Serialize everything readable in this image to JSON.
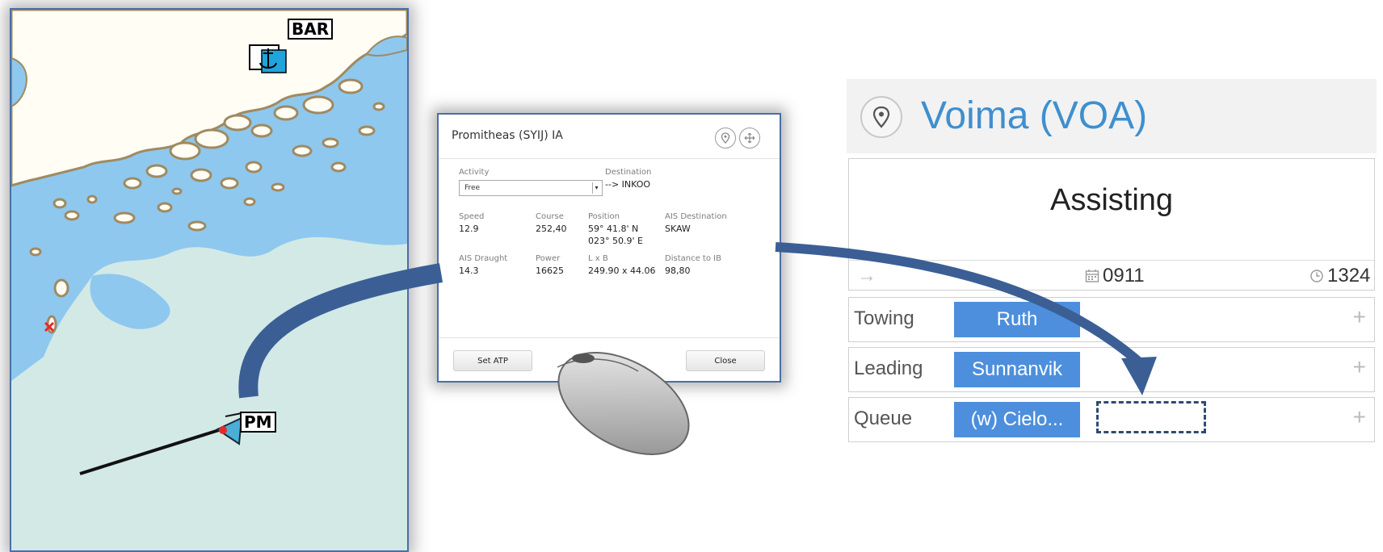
{
  "map": {
    "labels": {
      "bar": "BAR",
      "pm": "PM"
    },
    "colors": {
      "land": "#fffdf4",
      "coast": "#a08a60",
      "shallow": "#8ec8ef",
      "deep": "#d3e9e6",
      "track": "#111111",
      "ship": "#4aaed9",
      "highlight": "#e8292a"
    },
    "icons": [
      "anchor-icon",
      "ship-icon",
      "cross-marker-icon"
    ]
  },
  "dialog": {
    "title": "Promitheas (SYIJ) IA",
    "activity": {
      "label": "Activity",
      "value": "Free"
    },
    "destination": {
      "label": "Destination",
      "value": "--> INKOO"
    },
    "speed": {
      "label": "Speed",
      "value": "12.9"
    },
    "course": {
      "label": "Course",
      "value": "252,40"
    },
    "position": {
      "label": "Position",
      "lat": "59° 41.8' N",
      "lon": "023° 50.9' E"
    },
    "ais_destination": {
      "label": "AIS Destination",
      "value": "SKAW"
    },
    "ais_draught": {
      "label": "AIS Draught",
      "value": "14.3"
    },
    "power": {
      "label": "Power",
      "value": "16625"
    },
    "lxb": {
      "label": "L x B",
      "value": "249.90 x 44.06"
    },
    "distance_to_ib": {
      "label": "Distance to IB",
      "value": "98,80"
    },
    "buttons": {
      "set_atp": "Set ATP",
      "close": "Close"
    },
    "icons": [
      "map-pin-icon",
      "move-icon"
    ]
  },
  "icebreaker": {
    "title": "Voima (VOA)",
    "status": "Assisting",
    "strip": {
      "arrow": "→",
      "date_value": "0911",
      "time_value": "1324"
    },
    "rows": [
      {
        "label": "Towing",
        "chip": "Ruth",
        "plus": "+"
      },
      {
        "label": "Leading",
        "chip": "Sunnanvik",
        "plus": "+"
      },
      {
        "label": "Queue",
        "chip": "(w) Cielo...",
        "plus": "+"
      }
    ],
    "accent": "#3f8fce",
    "chip_color": "#4d8fdd"
  },
  "annotation": {
    "arrow_color": "#3b5f95",
    "mouse_color": "#b8b8b8"
  }
}
